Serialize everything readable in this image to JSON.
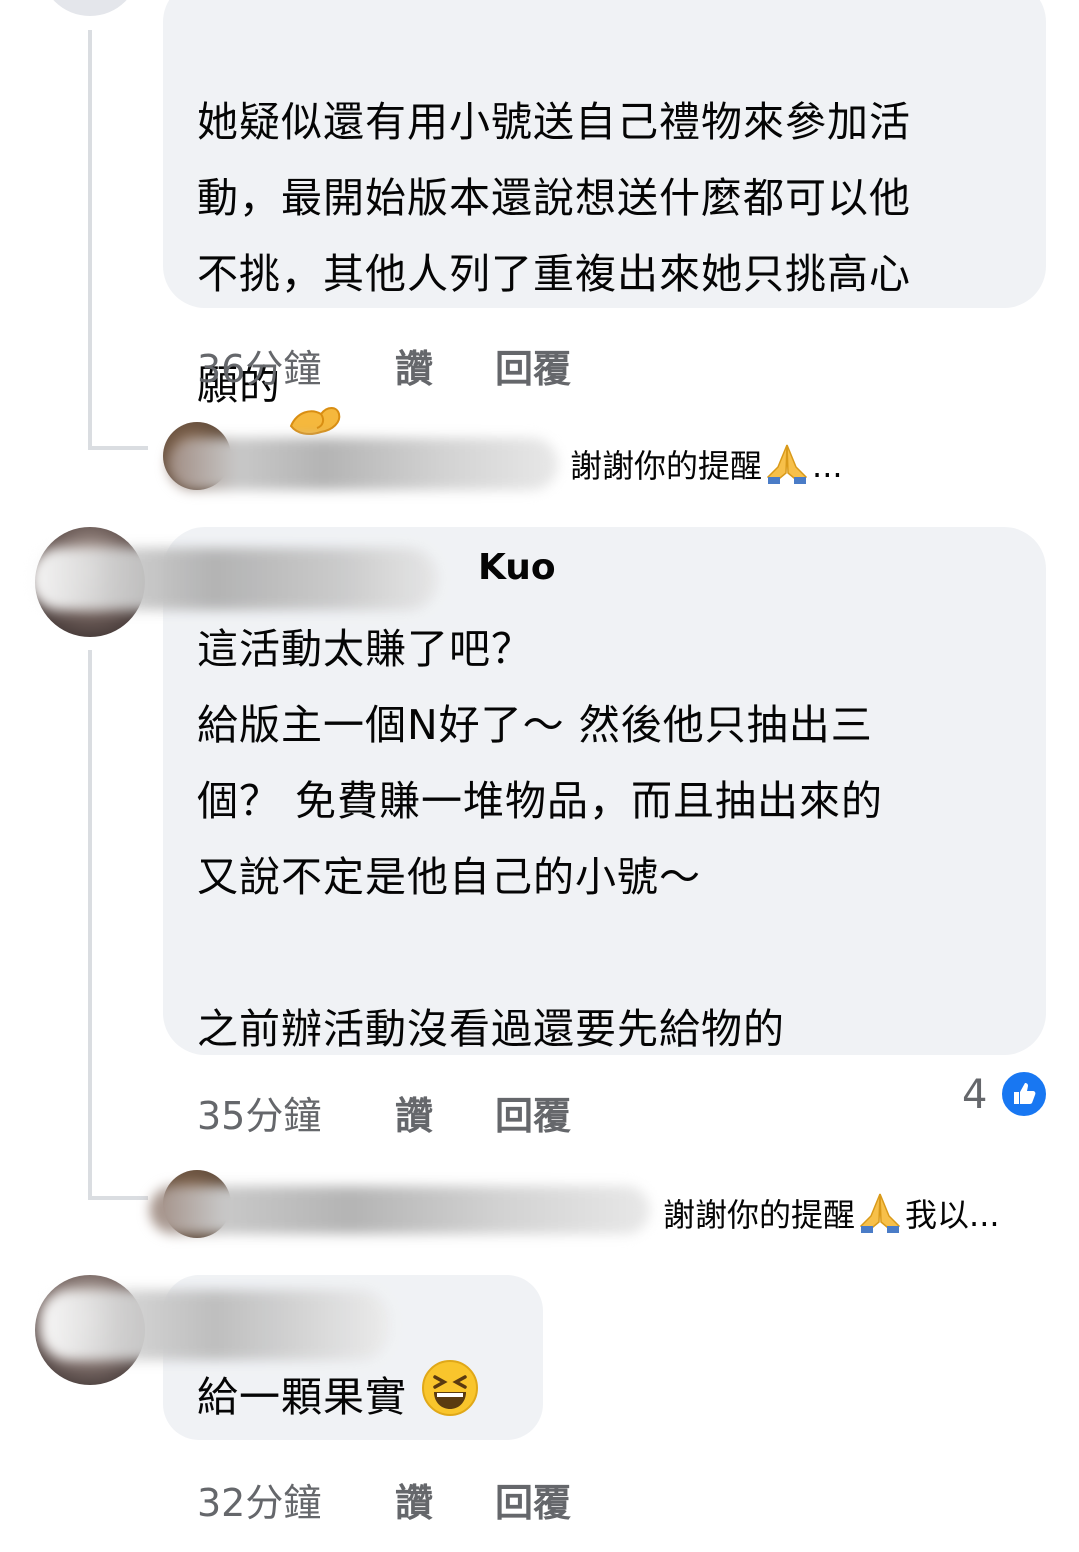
{
  "comments": [
    {
      "text": "她疑似還有用小號送自己禮物來參加活\n動，最開始版本還說想送什麼都可以他\n不挑，其他人列了重複出來她只挑高心\n願的",
      "time": "36分鐘",
      "like_label": "讚",
      "reply_label": "回覆",
      "reply_preview": "謝謝你的提醒",
      "reply_preview_suffix": "..."
    },
    {
      "author_partial": "Kuo",
      "text": "這活動太賺了吧？\n給版主一個N好了～ 然後他只抽出三\n個？ 免費賺一堆物品，而且抽出來的\n又說不定是他自己的小號～\n\n之前辦活動沒看過還要先給物的",
      "time": "35分鐘",
      "like_label": "讚",
      "reply_label": "回覆",
      "reaction_count": "4",
      "reply_preview": "謝謝你的提醒",
      "reply_preview_suffix": "我以..."
    },
    {
      "text": "給一顆果實",
      "time": "32分鐘",
      "like_label": "讚",
      "reply_label": "回覆"
    }
  ],
  "icons": {
    "pinched_hand": "pinching-hand-emoji-icon",
    "pray": "folded-hands-emoji-icon",
    "laugh": "grinning-squinting-face-emoji-icon",
    "like": "like-reaction-icon"
  },
  "colors": {
    "bubble_bg": "#f0f2f5",
    "meta_text": "#65676b",
    "like_blue": "#1877f2",
    "thread_line": "#dadde1"
  }
}
